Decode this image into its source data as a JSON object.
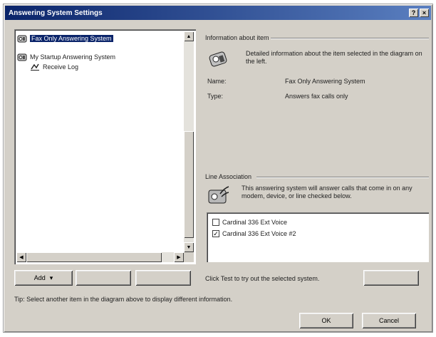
{
  "window": {
    "title": "Answering System Settings",
    "help_glyph": "?",
    "close_glyph": "×"
  },
  "tree": {
    "items": [
      {
        "label": "Fax Only Answering System",
        "icon": "answering-machine-icon",
        "selected": true
      },
      {
        "label": "My Startup Answering System",
        "icon": "answering-machine-icon",
        "selected": false
      },
      {
        "label": "Receive Log",
        "icon": "receive-log-icon",
        "selected": false
      }
    ]
  },
  "info": {
    "header": "Information about item",
    "description": "Detailed information about the item selected in the diagram on the left.",
    "name_label": "Name:",
    "name_value": "Fax Only Answering System",
    "type_label": "Type:",
    "type_value": "Answers fax calls only"
  },
  "line_association": {
    "header": "Line Association",
    "description": "This answering system will answer calls that come in on any modem, device, or line checked below.",
    "lines": [
      {
        "label": "Cardinal 336 Ext Voice",
        "checked": false
      },
      {
        "label": "Cardinal 336 Ext Voice #2",
        "checked": true
      }
    ]
  },
  "buttons": {
    "add": "Add",
    "add_arrow": "▾",
    "remove": "",
    "properties": "",
    "test": "",
    "ok": "OK",
    "cancel": "Cancel"
  },
  "test_hint": "Click Test to try out the selected system.",
  "tip": "Tip: Select another item in the diagram above to display different information.",
  "scroll": {
    "up": "▲",
    "down": "▼",
    "left": "◀",
    "right": "▶"
  }
}
